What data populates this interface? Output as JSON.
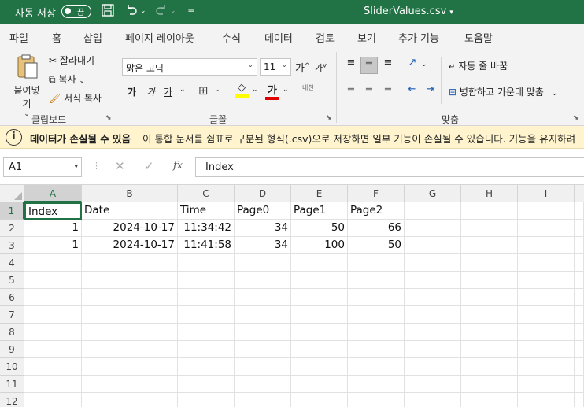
{
  "titlebar": {
    "autosave_label": "자동 저장",
    "autosave_state": "끔",
    "save_icon": "save-icon",
    "undo_icon": "undo-icon",
    "redo_icon": "redo-icon",
    "doc_title": "SliderValues.csv",
    "accent": "#217346"
  },
  "tabs": [
    "파일",
    "홈",
    "삽입",
    "페이지 레이아웃",
    "수식",
    "데이터",
    "검토",
    "보기",
    "추가 기능",
    "도움말"
  ],
  "active_tab": "홈",
  "ribbon": {
    "clipboard": {
      "paste": "붙여넣기",
      "cut": "잘라내기",
      "copy": "복사",
      "format_painter": "서식 복사",
      "group": "클립보드"
    },
    "font": {
      "name": "맑은 고딕",
      "size": "11",
      "bold": "가",
      "italic": "가",
      "underline": "가",
      "font_color": "가",
      "phonetic": "내천",
      "grow": "가",
      "shrink": "가",
      "group": "글꼴"
    },
    "alignment": {
      "wrap": "자동 줄 바꿈",
      "merge": "병합하고 가운데 맞춤",
      "group": "맞춤"
    }
  },
  "infobar": {
    "title": "데이터가 손실될 수 있음",
    "message": "이 통합 문서를 쉼표로 구분된 형식(.csv)으로 저장하면 일부 기능이 손실될 수 있습니다. 기능을 유지하려"
  },
  "formula_bar": {
    "name_box": "A1",
    "fx": "fx",
    "content": "Index"
  },
  "sheet": {
    "columns": [
      "A",
      "B",
      "C",
      "D",
      "E",
      "F",
      "G",
      "H",
      "I"
    ],
    "rows": [
      "1",
      "2",
      "3",
      "4",
      "5",
      "6",
      "7",
      "8",
      "9",
      "10",
      "11",
      "12"
    ],
    "cells": [
      [
        "Index",
        "Date",
        "Time",
        "Page0",
        "Page1",
        "Page2"
      ],
      [
        "1",
        "2024-10-17",
        "11:34:42",
        "34",
        "50",
        "66"
      ],
      [
        "1",
        "2024-10-17",
        "11:41:58",
        "34",
        "100",
        "50"
      ]
    ]
  }
}
